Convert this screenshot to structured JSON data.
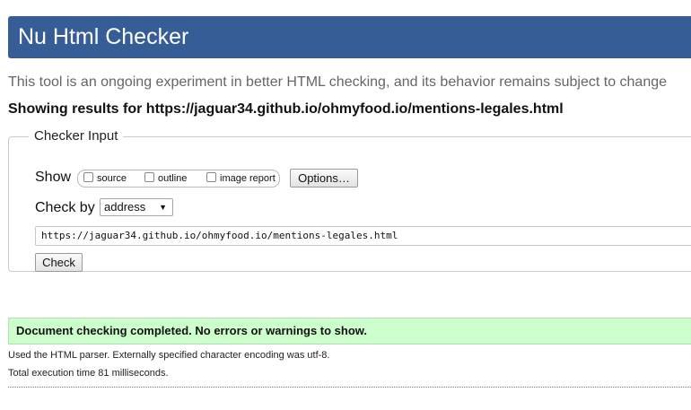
{
  "header": {
    "title": "Nu Html Checker"
  },
  "intro": "This tool is an ongoing experiment in better HTML checking, and its behavior remains subject to change",
  "results_heading": "Showing results for https://jaguar34.github.io/ohmyfood.io/mentions-legales.html",
  "checker": {
    "legend": "Checker Input",
    "show_label": "Show",
    "show_options": [
      "source",
      "outline",
      "image report"
    ],
    "options_button": "Options…",
    "checkby_label": "Check by",
    "checkby_value": "address",
    "url_value": "https://jaguar34.github.io/ohmyfood.io/mentions-legales.html",
    "check_button": "Check"
  },
  "result": {
    "message": "Document checking completed. No errors or warnings to show.",
    "parser_note": "Used the HTML parser. Externally specified character encoding was utf-8.",
    "execution_time": "Total execution time 81 milliseconds."
  }
}
